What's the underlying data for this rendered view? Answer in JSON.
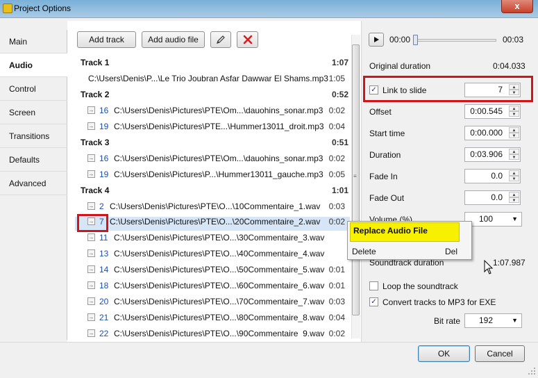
{
  "window": {
    "title": "Project Options",
    "close_glyph": "x"
  },
  "nav": {
    "items": [
      "Main",
      "Audio",
      "Control",
      "Screen",
      "Transitions",
      "Defaults",
      "Advanced"
    ],
    "active": "Audio"
  },
  "toolbar": {
    "add_track": "Add track",
    "add_audio_file": "Add audio file",
    "edit_icon": "pencil-icon",
    "delete_icon": "red-x-icon"
  },
  "tracks": [
    {
      "name": "Track 1",
      "duration": "1:07",
      "files": [
        {
          "num": "",
          "path": "C:\\Users\\Denis\\P...\\Le Trio Joubran Asfar Dawwar El Shams.mp3",
          "duration": "1:05"
        }
      ]
    },
    {
      "name": "Track 2",
      "duration": "0:52",
      "files": [
        {
          "num": "16",
          "path": "C:\\Users\\Denis\\Pictures\\PTE\\Om...\\dauohins_sonar.mp3",
          "duration": "0:02"
        },
        {
          "num": "19",
          "path": "C:\\Users\\Denis\\Pictures\\PTE...\\Hummer13011_droit.mp3",
          "duration": "0:04"
        }
      ]
    },
    {
      "name": "Track 3",
      "duration": "0:51",
      "files": [
        {
          "num": "16",
          "path": "C:\\Users\\Denis\\Pictures\\PTE\\Om...\\dauohins_sonar.mp3",
          "duration": "0:02"
        },
        {
          "num": "19",
          "path": "C:\\Users\\Denis\\Pictures\\P...\\Hummer13011_gauche.mp3",
          "duration": "0:05"
        }
      ]
    },
    {
      "name": "Track 4",
      "duration": "1:01",
      "files": [
        {
          "num": "2",
          "path": "C:\\Users\\Denis\\Pictures\\PTE\\O...\\10Commentaire_1.wav",
          "duration": "0:03"
        },
        {
          "num": "7",
          "path": "C:\\Users\\Denis\\Pictures\\PTE\\O...\\20Commentaire_2.wav",
          "duration": "0:02"
        },
        {
          "num": "11",
          "path": "C:\\Users\\Denis\\Pictures\\PTE\\O...\\30Commentaire_3.wav",
          "duration": ""
        },
        {
          "num": "13",
          "path": "C:\\Users\\Denis\\Pictures\\PTE\\O...\\40Commentaire_4.wav",
          "duration": ""
        },
        {
          "num": "14",
          "path": "C:\\Users\\Denis\\Pictures\\PTE\\O...\\50Commentaire_5.wav",
          "duration": "0:01"
        },
        {
          "num": "18",
          "path": "C:\\Users\\Denis\\Pictures\\PTE\\O...\\60Commentaire_6.wav",
          "duration": "0:01"
        },
        {
          "num": "20",
          "path": "C:\\Users\\Denis\\Pictures\\PTE\\O...\\70Commentaire_7.wav",
          "duration": "0:03"
        },
        {
          "num": "21",
          "path": "C:\\Users\\Denis\\Pictures\\PTE\\O...\\80Commentaire_8.wav",
          "duration": "0:04"
        },
        {
          "num": "22",
          "path": "C:\\Users\\Denis\\Pictures\\PTE\\O...\\90Commentaire_9.wav",
          "duration": "0:02"
        }
      ]
    }
  ],
  "player": {
    "current": "00:00",
    "end": "00:03",
    "position_fraction": 0.0
  },
  "props": {
    "original_duration_label": "Original duration",
    "original_duration": "0:04.033",
    "link_to_slide_label": "Link to slide",
    "link_to_slide_checked": true,
    "link_to_slide_value": "7",
    "offset_label": "Offset",
    "offset": "0:00.545",
    "start_time_label": "Start time",
    "start_time": "0:00.000",
    "duration_label": "Duration",
    "duration": "0:03.906",
    "fade_in_label": "Fade In",
    "fade_in": "0.0",
    "fade_out_label": "Fade Out",
    "fade_out": "0.0",
    "volume_label": "Volume (%)",
    "volume": "100",
    "soundtrack_duration_label": "Soundtrack duration",
    "soundtrack_duration": "1:07.987",
    "loop_label": "Loop the soundtrack",
    "loop_checked": false,
    "convert_label": "Convert tracks to MP3 for EXE",
    "convert_checked": true,
    "bitrate_label": "Bit rate",
    "bitrate": "192"
  },
  "context_menu": {
    "replace": "Replace Audio File",
    "delete": "Delete",
    "delete_shortcut": "Del"
  },
  "footer": {
    "ok": "OK",
    "cancel": "Cancel"
  },
  "colors": {
    "highlight_red": "#d0141a",
    "menu_yellow": "#f7f000",
    "selection_blue": "#d6e6f7"
  }
}
